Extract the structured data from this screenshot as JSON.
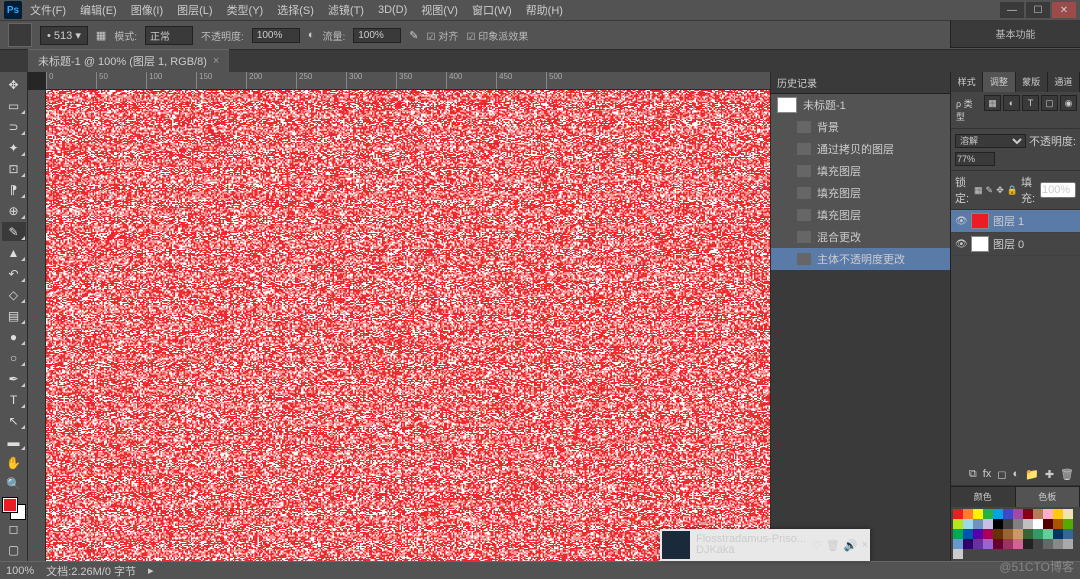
{
  "menu": {
    "items": [
      "文件(F)",
      "编辑(E)",
      "图像(I)",
      "图层(L)",
      "类型(Y)",
      "选择(S)",
      "滤镜(T)",
      "3D(D)",
      "视图(V)",
      "窗口(W)",
      "帮助(H)"
    ]
  },
  "optbar": {
    "mode_label": "模式:",
    "mode_value": "正常",
    "opacity_label": "不透明度:",
    "opacity_value": "100%",
    "flow_label": "流量:",
    "flow_value": "100%"
  },
  "collapse_label": "基本功能",
  "doc_tab": {
    "title": "未标题-1 @ 100% (图层 1, RGB/8)"
  },
  "ruler_marks": [
    "0",
    "50",
    "100",
    "150",
    "200",
    "250",
    "300",
    "350",
    "400",
    "450",
    "500"
  ],
  "history": {
    "title": "历史记录",
    "doc": "未标题-1",
    "items": [
      "背景",
      "通过拷贝的图层",
      "填充图层",
      "填充图层",
      "填充图层",
      "混合更改",
      "主体不透明度更改"
    ],
    "selected": 6
  },
  "layers_panel": {
    "tabs": [
      "样式",
      "调整",
      "蒙版",
      "通道"
    ],
    "kind_label": "ρ 类型",
    "kind_dd": "⌄",
    "blend": "溶解",
    "opacity_label": "不透明度:",
    "opacity": "77%",
    "lock_label": "锁定:",
    "fill_label": "填充:",
    "fill": "100%",
    "layers": [
      {
        "name": "图层 1",
        "sel": true,
        "color": "red"
      },
      {
        "name": "图层 0",
        "sel": false,
        "color": "white"
      }
    ]
  },
  "color_panel": {
    "tabs": [
      "颜色",
      "色板"
    ]
  },
  "status": {
    "zoom": "100%",
    "info": "文档:2.26M/0 字节"
  },
  "music": {
    "title": "Flosstradamus-Priso...",
    "artist": "DJKäkä"
  },
  "watermark": "@51CTO博客",
  "swatch_colors": [
    "#ed1c24",
    "#ff7f27",
    "#fff200",
    "#22b14c",
    "#00a2e8",
    "#3f48cc",
    "#a349a4",
    "#880015",
    "#b97a57",
    "#ffaec9",
    "#ffc90e",
    "#efe4b0",
    "#b5e61d",
    "#99d9ea",
    "#7092be",
    "#c8bfe7",
    "#000000",
    "#404040",
    "#808080",
    "#c0c0c0",
    "#ffffff",
    "#550000",
    "#aa5500",
    "#55aa00",
    "#00aa55",
    "#0055aa",
    "#5500aa",
    "#aa0055",
    "#663300",
    "#996633",
    "#cc9966",
    "#336633",
    "#339966",
    "#66cc99",
    "#003366",
    "#336699",
    "#6699cc",
    "#330066",
    "#663399",
    "#9966cc",
    "#660033",
    "#993366",
    "#cc6699",
    "#222",
    "#444",
    "#666",
    "#888",
    "#aaa",
    "#ccc"
  ]
}
